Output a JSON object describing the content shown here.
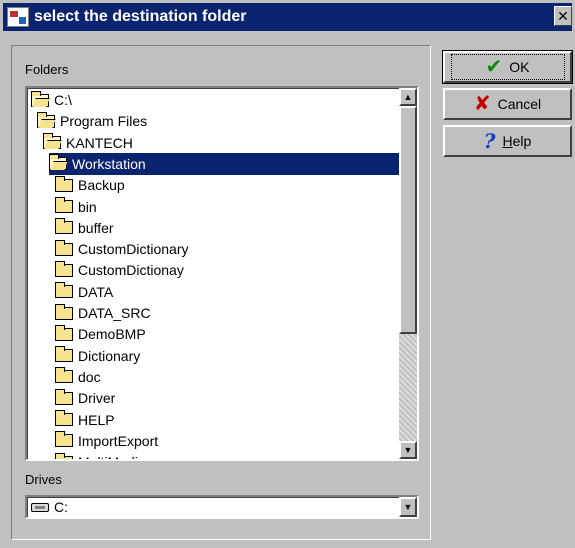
{
  "window": {
    "title": "select the destination folder",
    "close_glyph": "✕"
  },
  "folders_label": "Folders",
  "drives_label": "Drives",
  "tree": {
    "items": [
      {
        "label": "C:\\",
        "icon": "open-folder-icon",
        "indent": 0,
        "selected": false
      },
      {
        "label": "Program Files",
        "icon": "open-folder-icon",
        "indent": 1,
        "selected": false
      },
      {
        "label": "KANTECH",
        "icon": "open-folder-icon",
        "indent": 2,
        "selected": false
      },
      {
        "label": "Workstation",
        "icon": "open-folder-icon",
        "indent": 3,
        "selected": true
      },
      {
        "label": "Backup",
        "icon": "folder-icon",
        "indent": 4,
        "selected": false
      },
      {
        "label": "bin",
        "icon": "folder-icon",
        "indent": 4,
        "selected": false
      },
      {
        "label": "buffer",
        "icon": "folder-icon",
        "indent": 4,
        "selected": false
      },
      {
        "label": "CustomDictionary",
        "icon": "folder-icon",
        "indent": 4,
        "selected": false
      },
      {
        "label": "CustomDictionay",
        "icon": "folder-icon",
        "indent": 4,
        "selected": false
      },
      {
        "label": "DATA",
        "icon": "folder-icon",
        "indent": 4,
        "selected": false
      },
      {
        "label": "DATA_SRC",
        "icon": "folder-icon",
        "indent": 4,
        "selected": false
      },
      {
        "label": "DemoBMP",
        "icon": "folder-icon",
        "indent": 4,
        "selected": false
      },
      {
        "label": "Dictionary",
        "icon": "folder-icon",
        "indent": 4,
        "selected": false
      },
      {
        "label": "doc",
        "icon": "folder-icon",
        "indent": 4,
        "selected": false
      },
      {
        "label": "Driver",
        "icon": "folder-icon",
        "indent": 4,
        "selected": false
      },
      {
        "label": "HELP",
        "icon": "folder-icon",
        "indent": 4,
        "selected": false
      },
      {
        "label": "ImportExport",
        "icon": "folder-icon",
        "indent": 4,
        "selected": false
      },
      {
        "label": "MultiMedia",
        "icon": "folder-icon",
        "indent": 4,
        "selected": false
      }
    ]
  },
  "drives": {
    "selected": "C:"
  },
  "buttons": {
    "ok": {
      "label": "OK",
      "icon": "check-icon"
    },
    "cancel": {
      "label": "Cancel",
      "icon": "x-icon"
    },
    "help": {
      "label_ul": "H",
      "label_rest": "elp",
      "icon": "question-icon"
    }
  },
  "colors": {
    "titlebar": "#0a2470",
    "selection": "#0a2470",
    "face": "#c0c0c0"
  }
}
